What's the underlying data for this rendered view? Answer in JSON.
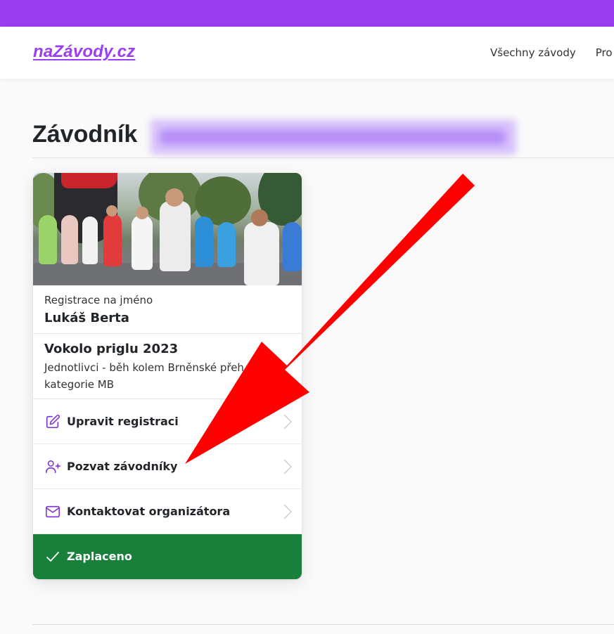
{
  "brand": {
    "logo_text": "naZávody.cz",
    "color": "#9b3df0"
  },
  "nav": {
    "items": [
      "Všechny závody",
      "Pro"
    ]
  },
  "page": {
    "title": "Závodník"
  },
  "registration": {
    "label": "Registrace na jméno",
    "name": "Lukáš Berta"
  },
  "event": {
    "name": "Vokolo priglu 2023",
    "race": "Jednotlivci - běh kolem Brněnské přeh",
    "category": "kategorie MB"
  },
  "actions": [
    {
      "label": "Upravit registraci",
      "icon": "edit-icon"
    },
    {
      "label": "Pozvat závodníky",
      "icon": "user-plus-icon"
    },
    {
      "label": "Kontaktovat organizátora",
      "icon": "mail-icon"
    }
  ],
  "status": {
    "label": "Zaplaceno",
    "icon": "check-icon",
    "color": "#19803c"
  },
  "colors": {
    "accent": "#9b3df0",
    "annotation_arrow": "#ff0000"
  }
}
